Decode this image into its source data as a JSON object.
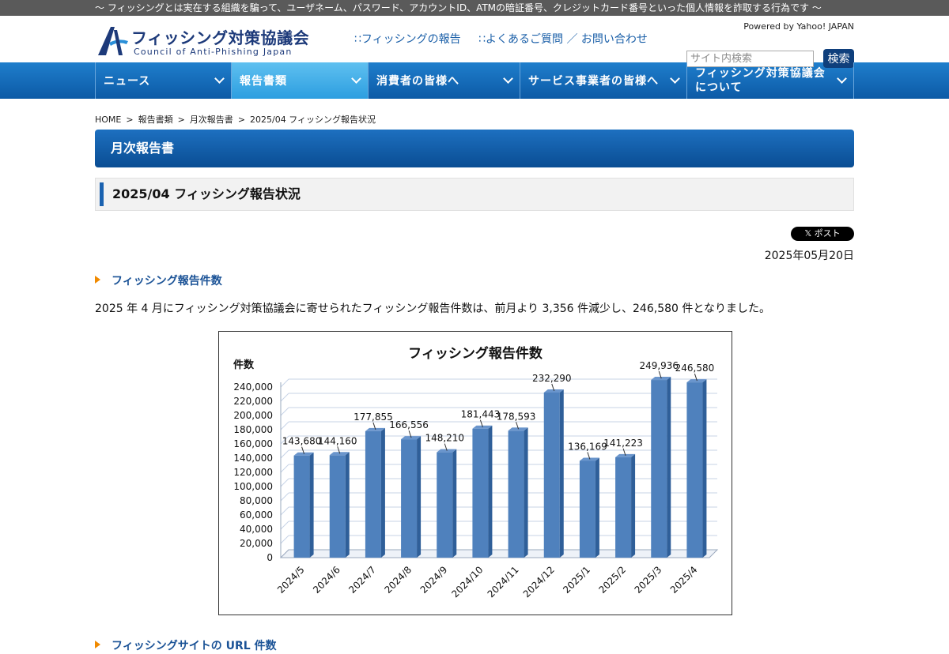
{
  "topbar": {
    "text": "～ フィッシングとは実在する組織を騙って、ユーザネーム、パスワード、アカウントID、ATMの暗証番号、クレジットカード番号といった個人情報を詐取する行為です ～"
  },
  "header": {
    "logo_jp": "フィッシング対策協議会",
    "logo_en": "Council of Anti-Phishing Japan",
    "links": [
      "∷フィッシングの報告",
      "∷よくあるご質問 ／ お問い合わせ"
    ],
    "powered": "Powered by Yahoo! JAPAN",
    "search_placeholder": "サイト内検索",
    "search_button": "検索"
  },
  "nav": {
    "items": [
      {
        "label": "ニュース",
        "active": false
      },
      {
        "label": "報告書類",
        "active": true
      },
      {
        "label": "消費者の皆様へ",
        "active": false
      },
      {
        "label": "サービス事業者の皆様へ",
        "active": false
      },
      {
        "label_line1": "フィッシング対策協議会",
        "label_line2": "について",
        "active": false
      }
    ]
  },
  "breadcrumb": [
    "HOME",
    "報告書類",
    "月次報告書",
    "2025/04 フィッシング報告状況"
  ],
  "section_banner": "月次報告書",
  "page_title": "2025/04 フィッシング報告状況",
  "post_button": "𝕏 ポスト",
  "post_date": "2025年05月20日",
  "subheads": [
    "フィッシング報告件数",
    "フィッシングサイトの URL 件数"
  ],
  "paragraph": "2025 年 4 月にフィッシング対策協議会に寄せられたフィッシング報告件数は、前月より 3,356 件減少し、246,580 件となりました。",
  "colors": {
    "bar": "#4f81bd",
    "bar_side": "#2f5f99",
    "bar_top": "#6a95cc",
    "accent": "#1a62b0",
    "grid": "#c7d3e6"
  },
  "chart_data": {
    "type": "bar",
    "title": "フィッシング報告件数",
    "ylabel": "件数",
    "xlabel": "",
    "categories": [
      "2024/5",
      "2024/6",
      "2024/7",
      "2024/8",
      "2024/9",
      "2024/10",
      "2024/11",
      "2024/12",
      "2025/1",
      "2025/2",
      "2025/3",
      "2025/4"
    ],
    "values": [
      143680,
      144160,
      177855,
      166556,
      148210,
      181443,
      178593,
      232290,
      136169,
      141223,
      249936,
      246580
    ],
    "value_labels": [
      "143,680",
      "144,160",
      "177,855",
      "166,556",
      "148,210",
      "181,443",
      "178,593",
      "232,290",
      "136,169",
      "141,223",
      "249,936",
      "246,580"
    ],
    "yticks": [
      "0",
      "20,000",
      "40,000",
      "60,000",
      "80,000",
      "100,000",
      "120,000",
      "140,000",
      "160,000",
      "180,000",
      "200,000",
      "220,000",
      "240,000"
    ],
    "ylim": [
      0,
      240000
    ],
    "grid": true,
    "legend": "none"
  }
}
